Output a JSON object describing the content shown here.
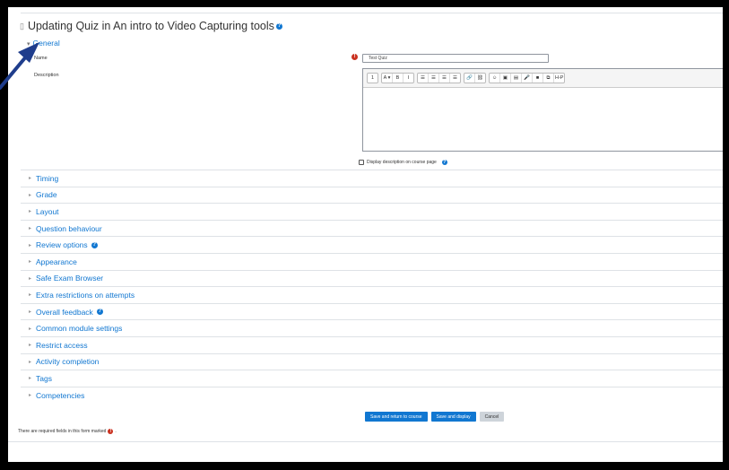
{
  "page": {
    "title": "Updating Quiz in An intro to Video Capturing tools",
    "title_icon": "file-icon"
  },
  "general": {
    "section_label": "General",
    "name_label": "Name",
    "name_value": "Test Quiz",
    "description_label": "Description",
    "display_description_label": "Display description on course page"
  },
  "editor": {
    "toolbar": [
      [
        "1"
      ],
      [
        "A ▾",
        "B",
        "I"
      ],
      [
        "☰",
        "☰",
        "☰",
        "☰"
      ],
      [
        "🔗",
        "⛓"
      ],
      [
        "☺",
        "▣",
        "▤",
        "🎤",
        "■",
        "⧉",
        "H-P"
      ]
    ]
  },
  "sections": [
    {
      "label": "Timing",
      "help": false
    },
    {
      "label": "Grade",
      "help": false
    },
    {
      "label": "Layout",
      "help": false
    },
    {
      "label": "Question behaviour",
      "help": false
    },
    {
      "label": "Review options",
      "help": true
    },
    {
      "label": "Appearance",
      "help": false
    },
    {
      "label": "Safe Exam Browser",
      "help": false
    },
    {
      "label": "Extra restrictions on attempts",
      "help": false
    },
    {
      "label": "Overall feedback",
      "help": true
    },
    {
      "label": "Common module settings",
      "help": false
    },
    {
      "label": "Restrict access",
      "help": false
    },
    {
      "label": "Activity completion",
      "help": false
    },
    {
      "label": "Tags",
      "help": false
    },
    {
      "label": "Competencies",
      "help": false
    }
  ],
  "buttons": {
    "save_return": "Save and return to course",
    "save_display": "Save and display",
    "cancel": "Cancel"
  },
  "required_note": "There are required fields in this form marked",
  "required_note_suffix": ".",
  "colors": {
    "link": "#1177d1",
    "required": "#ca3120",
    "primary_button": "#1177d1",
    "arrow": "#1f3d8c"
  }
}
